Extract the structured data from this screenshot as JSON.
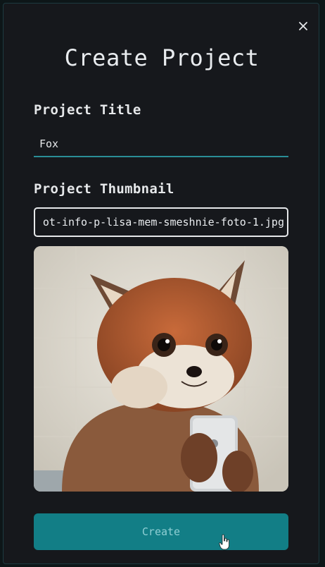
{
  "modal": {
    "title": "Create Project",
    "close_icon": "close-icon",
    "project_title": {
      "label": "Project Title",
      "value": "Fox"
    },
    "project_thumbnail": {
      "label": "Project Thumbnail",
      "file_value": "ot-info-p-lisa-mem-smeshnie-foto-1.jpg",
      "preview": "fox-selfie-thumbnail-image"
    },
    "create_button": {
      "label": "Create"
    }
  },
  "colors": {
    "accent": "#127e86",
    "underline": "#2a8e96",
    "background": "#16181c"
  }
}
